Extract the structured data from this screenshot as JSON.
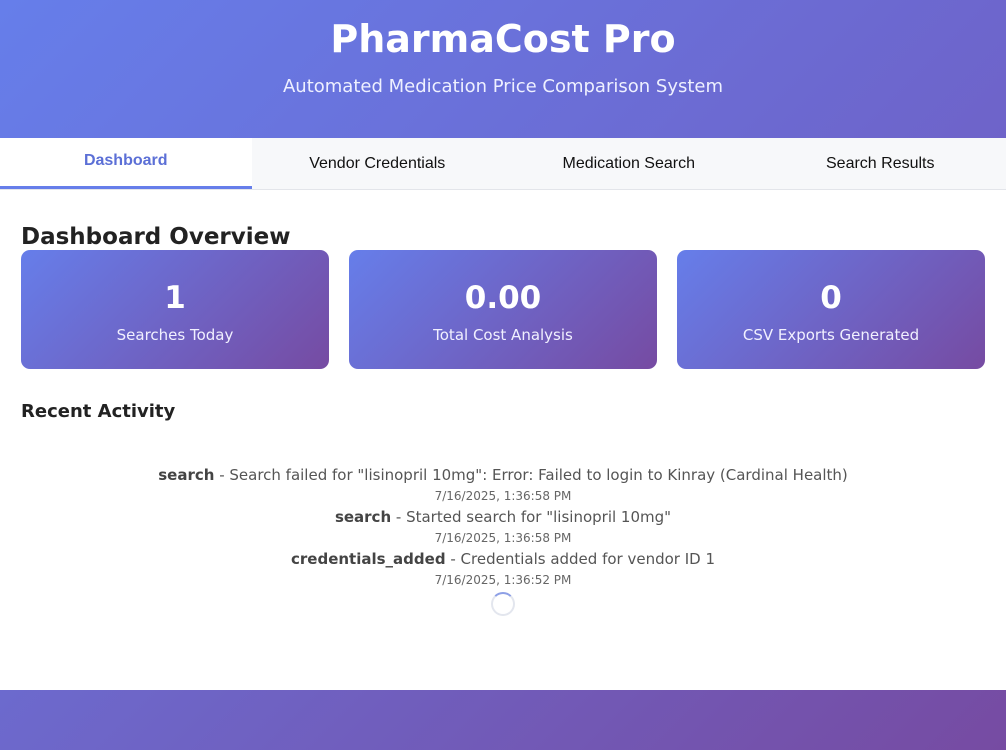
{
  "header": {
    "title": "PharmaCost Pro",
    "subtitle": "Automated Medication Price Comparison System"
  },
  "nav": {
    "tabs": [
      {
        "label": "Dashboard",
        "active": true
      },
      {
        "label": "Vendor Credentials",
        "active": false
      },
      {
        "label": "Medication Search",
        "active": false
      },
      {
        "label": "Search Results",
        "active": false
      }
    ]
  },
  "dashboard": {
    "title": "Dashboard Overview",
    "stats": [
      {
        "value": "1",
        "label": "Searches Today"
      },
      {
        "value": "0.00",
        "label": "Total Cost Analysis"
      },
      {
        "value": "0",
        "label": "CSV Exports Generated"
      }
    ],
    "activity_title": "Recent Activity",
    "activity": [
      {
        "type": "search",
        "message": " - Search failed for \"lisinopril 10mg\": Error: Failed to login to Kinray (Cardinal Health)",
        "time": "7/16/2025, 1:36:58 PM"
      },
      {
        "type": "search",
        "message": " - Started search for \"lisinopril 10mg\"",
        "time": "7/16/2025, 1:36:58 PM"
      },
      {
        "type": "credentials_added",
        "message": " - Credentials added for vendor ID 1",
        "time": "7/16/2025, 1:36:52 PM"
      }
    ]
  },
  "colors": {
    "accent": "#667eea",
    "accent_end": "#764ba2",
    "active_tab_text": "#5b6fd6"
  }
}
